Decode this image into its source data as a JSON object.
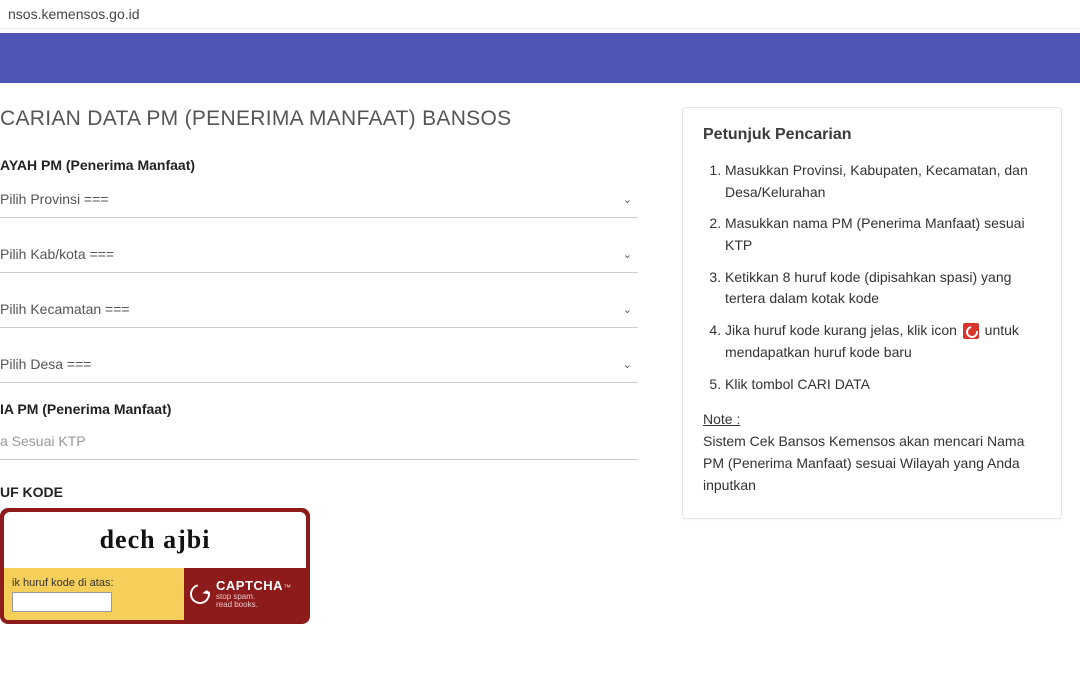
{
  "url": "nsos.kemensos.go.id",
  "main": {
    "title": "CARIAN DATA PM (PENERIMA MANFAAT) BANSOS",
    "section_wilayah": "AYAH PM (Penerima Manfaat)",
    "provinsi": "Pilih Provinsi ===",
    "kabkota": "Pilih Kab/kota ===",
    "kecamatan": "Pilih Kecamatan ===",
    "desa": "Pilih Desa ===",
    "section_nama": "IA PM (Penerima Manfaat)",
    "nama_placeholder": "a Sesuai KTP",
    "section_kode": "UF KODE",
    "captcha_text": "dech  ajbi",
    "captcha_hint": "ik huruf kode di atas:",
    "captcha_brand": "CAPTCHA",
    "captcha_tm": "™",
    "captcha_tag1": "stop spam.",
    "captcha_tag2": "read books."
  },
  "side": {
    "title": "Petunjuk Pencarian",
    "steps": [
      "Masukkan Provinsi, Kabupaten, Kecamatan, dan Desa/Kelurahan",
      "Masukkan nama PM (Penerima Manfaat) sesuai KTP",
      "Ketikkan 8 huruf kode (dipisahkan spasi) yang tertera dalam kotak kode",
      "Jika huruf kode kurang jelas, klik icon ",
      " untuk mendapatkan huruf kode baru",
      "Klik tombol CARI DATA"
    ],
    "note_head": "Note :",
    "note_body": "Sistem Cek Bansos Kemensos akan mencari Nama PM (Penerima Manfaat) sesuai Wilayah yang Anda inputkan"
  }
}
